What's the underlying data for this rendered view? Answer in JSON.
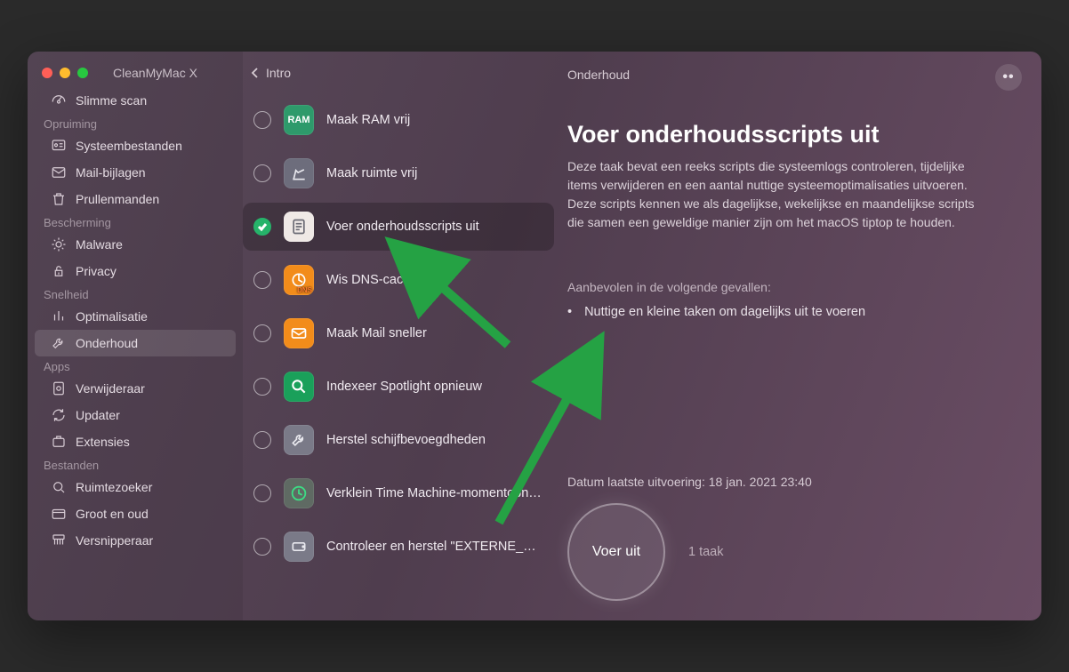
{
  "app_title": "CleanMyMac X",
  "back_label": "Intro",
  "section_name": "Onderhoud",
  "sidebar": {
    "smart_scan": "Slimme scan",
    "groups": [
      {
        "label": "Opruiming",
        "items": [
          "Systeembestanden",
          "Mail-bijlagen",
          "Prullenmanden"
        ]
      },
      {
        "label": "Bescherming",
        "items": [
          "Malware",
          "Privacy"
        ]
      },
      {
        "label": "Snelheid",
        "items": [
          "Optimalisatie",
          "Onderhoud"
        ]
      },
      {
        "label": "Apps",
        "items": [
          "Verwijderaar",
          "Updater",
          "Extensies"
        ]
      },
      {
        "label": "Bestanden",
        "items": [
          "Ruimtezoeker",
          "Groot en oud",
          "Versnipperaar"
        ]
      }
    ],
    "active": "Onderhoud"
  },
  "tasks": [
    {
      "label": "Maak RAM vrij",
      "icon": "ram",
      "color": "#2e9a6b",
      "checked": false
    },
    {
      "label": "Maak ruimte vrij",
      "icon": "broom",
      "color": "#6d6d7c",
      "checked": false
    },
    {
      "label": "Voer onderhoudsscripts uit",
      "icon": "script",
      "color": "#efe9e6",
      "checked": true
    },
    {
      "label": "Wis DNS-cache",
      "icon": "dns",
      "color": "#f28c1a",
      "checked": false
    },
    {
      "label": "Maak Mail sneller",
      "icon": "mail",
      "color": "#f28c1a",
      "checked": false
    },
    {
      "label": "Indexeer Spotlight opnieuw",
      "icon": "spotlight",
      "color": "#1aa05a",
      "checked": false
    },
    {
      "label": "Herstel schijfbevoegdheden",
      "icon": "wrench",
      "color": "#7a7a88",
      "checked": false
    },
    {
      "label": "Verklein Time Machine-momentopnam…",
      "icon": "timemachine",
      "color": "#259a60",
      "checked": false
    },
    {
      "label": "Controleer en herstel \"EXTERNE_HD\"",
      "icon": "disk",
      "color": "#7a7a88",
      "checked": false
    }
  ],
  "detail": {
    "title": "Voer onderhoudsscripts uit",
    "description": "Deze taak bevat een reeks scripts die systeemlogs controleren, tijdelijke items verwijderen en een aantal nuttige systeemoptimalisaties uitvoeren. Deze scripts kennen we als dagelijkse, wekelijkse en maandelijkse scripts die samen een geweldige manier zijn om het macOS tiptop te houden.",
    "recommended_heading": "Aanbevolen in de volgende gevallen:",
    "recommended_items": [
      "Nuttige en kleine taken om dagelijks uit te voeren"
    ],
    "last_run_label": "Datum laatste uitvoering:",
    "last_run_value": "18 jan. 2021 23:40",
    "run_button": "Voer uit",
    "task_count": "1 taak"
  }
}
